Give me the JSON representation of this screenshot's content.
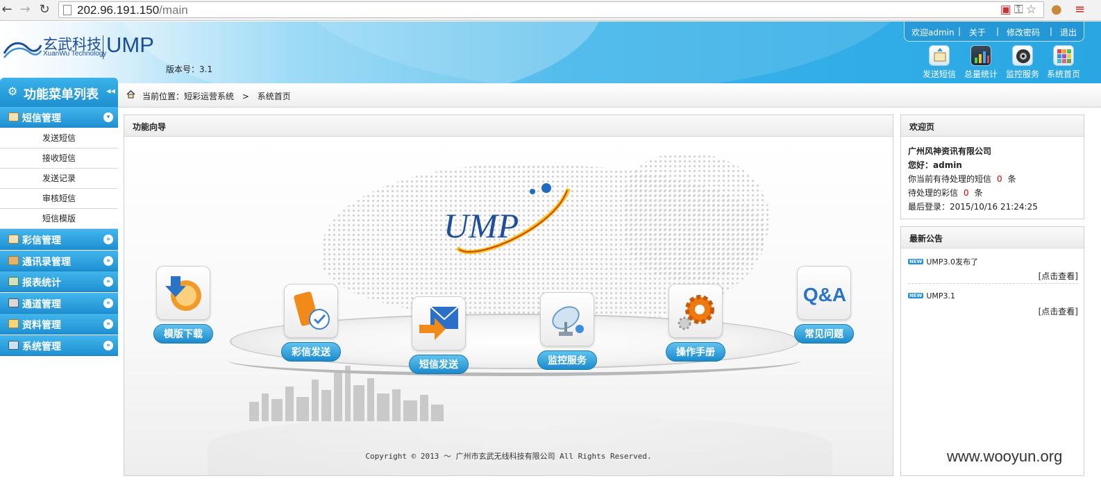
{
  "browser": {
    "url_host": "202.96.191.150",
    "url_path": "/main",
    "nav_icons": [
      "back-icon",
      "forward-icon",
      "reload-icon"
    ]
  },
  "header": {
    "logo_cn": "玄武科技",
    "logo_en": "XuanWu Technology",
    "logo_product": "UMP",
    "version": "版本号：3.1",
    "user_links": {
      "welcome": "欢迎admin",
      "about": "关于",
      "change_password": "修改密码",
      "logout": "退出"
    },
    "quick_links": [
      {
        "label": "发送短信",
        "icon": "send-sms-icon"
      },
      {
        "label": "总量统计",
        "icon": "statistics-icon"
      },
      {
        "label": "监控服务",
        "icon": "monitor-icon"
      },
      {
        "label": "系统首页",
        "icon": "home-grid-icon"
      }
    ]
  },
  "sidebar": {
    "title": "功能菜单列表",
    "groups": [
      {
        "label": "短信管理",
        "expanded": true,
        "items": [
          "发送短信",
          "接收短信",
          "发送记录",
          "审核短信",
          "短信模版"
        ]
      },
      {
        "label": "彩信管理",
        "expanded": false
      },
      {
        "label": "通讯录管理",
        "expanded": false
      },
      {
        "label": "报表统计",
        "expanded": false
      },
      {
        "label": "通道管理",
        "expanded": false
      },
      {
        "label": "资料管理",
        "expanded": false
      },
      {
        "label": "系统管理",
        "expanded": false
      }
    ]
  },
  "breadcrumb": {
    "prefix": "当前位置：",
    "items": [
      "短彩运营系统",
      "系统首页"
    ],
    "separator": ">"
  },
  "guide": {
    "title": "功能向导",
    "logo_text": "UMP",
    "items": [
      {
        "label": "模版下载",
        "icon": "template-download-icon"
      },
      {
        "label": "彩信发送",
        "icon": "mms-send-icon"
      },
      {
        "label": "短信发送",
        "icon": "sms-send-icon"
      },
      {
        "label": "监控服务",
        "icon": "monitor-service-icon"
      },
      {
        "label": "操作手册",
        "icon": "manual-gear-icon"
      },
      {
        "label": "常见问题",
        "icon": "qa-icon"
      }
    ],
    "qa_text": "Q&A",
    "copyright": "Copyright  ©  2013   〜  广州市玄武无线科技有限公司  All Rights Reserved."
  },
  "welcome_panel": {
    "title": "欢迎页",
    "company": "广州风神资讯有限公司",
    "greeting": "您好：admin",
    "pending_sms_prefix": "你当前有待处理的短信",
    "pending_sms_count": "0",
    "pending_mms_prefix": "待处理的彩信",
    "pending_mms_count": "0",
    "unit": "条",
    "last_login": "最后登录：2015/10/16 21:24:25"
  },
  "notice_panel": {
    "title": "最新公告",
    "badge": "NEW",
    "items": [
      {
        "title": "UMP3.0发布了",
        "link": "[点击查看]"
      },
      {
        "title": "UMP3.1",
        "link": "[点击查看]"
      }
    ]
  },
  "watermark": "www.wooyun.org",
  "colors": {
    "header_blue": "#28a7e3",
    "menu_blue": "#1f90d2",
    "brand_dark_blue": "#1a4d9a",
    "alert_red": "#e00000"
  }
}
